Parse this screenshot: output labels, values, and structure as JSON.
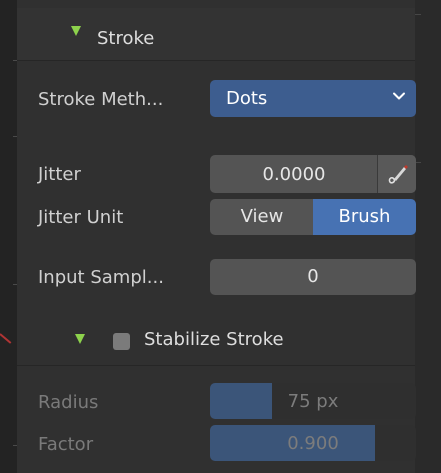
{
  "panel": {
    "section_title": "Stroke",
    "stroke_method": {
      "label": "Stroke Meth...",
      "value": "Dots"
    },
    "jitter": {
      "label": "Jitter",
      "value": "0.0000"
    },
    "jitter_unit": {
      "label": "Jitter Unit",
      "options": [
        "View",
        "Brush"
      ],
      "selected": "Brush"
    },
    "input_samples": {
      "label": "Input Sampl...",
      "value": "0"
    },
    "stabilize": {
      "label": "Stabilize Stroke",
      "enabled": false,
      "radius": {
        "label": "Radius",
        "value": "75 px",
        "fill_fraction": 0.3
      },
      "factor": {
        "label": "Factor",
        "value": "0.900",
        "fill_fraction": 0.8
      }
    }
  },
  "colors": {
    "accent_green": "#8dd24c",
    "selected_blue": "#4772b3",
    "dropdown_blue": "#3d5d8f"
  }
}
